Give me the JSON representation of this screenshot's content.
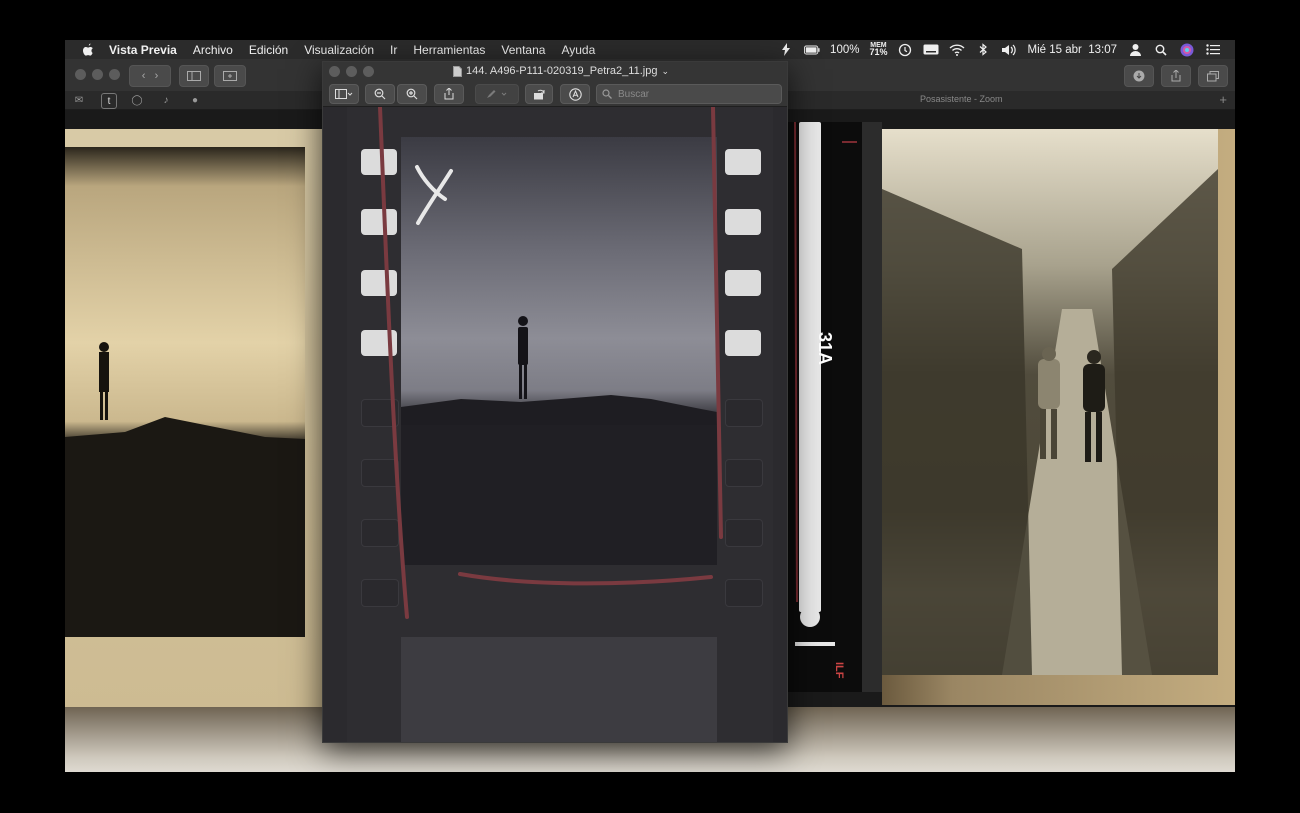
{
  "menubar": {
    "app_name": "Vista Previa",
    "menus": [
      "Archivo",
      "Edición",
      "Visualización",
      "Ir",
      "Herramientas",
      "Ventana",
      "Ayuda"
    ],
    "battery": "100%",
    "mem_label": "MEM",
    "mem_value": "71%",
    "datetime": "Mié 15 abr  13:07"
  },
  "back_window": {
    "zoom_label": "Posasistente - Zoom"
  },
  "film_strip": {
    "label": "31A",
    "bottom_text": "ILF"
  },
  "preview_window": {
    "filename": "144. A496-P111-020319_Petra2_11.jpg",
    "search_placeholder": "Buscar"
  },
  "colors": {
    "annotation_red": "#7a3a40",
    "annotation_white": "#e8e8e8"
  }
}
